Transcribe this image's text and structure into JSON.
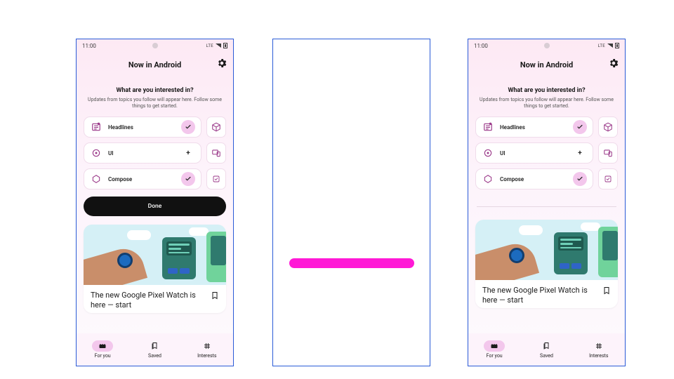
{
  "statusbar": {
    "time": "11:00",
    "network": "LTE"
  },
  "appbar": {
    "title": "Now in Android"
  },
  "onboarding": {
    "heading": "What are you interested in?",
    "subheading": "Updates from topics you follow will appear here. Follow some things to get started.",
    "done_label": "Done"
  },
  "topics": [
    {
      "icon": "headlines",
      "label": "Headlines",
      "selected": true,
      "side_icon": "cube"
    },
    {
      "icon": "ui",
      "label": "UI",
      "selected": false,
      "side_icon": "devices"
    },
    {
      "icon": "compose",
      "label": "Compose",
      "selected": true,
      "side_icon": "check-square"
    }
  ],
  "feed_card": {
    "title": "The new Google Pixel Watch is here  — start"
  },
  "nav": {
    "items": [
      {
        "key": "foryou",
        "label": "For you",
        "active": true
      },
      {
        "key": "saved",
        "label": "Saved",
        "active": false
      },
      {
        "key": "interests",
        "label": "Interests",
        "active": false
      }
    ]
  },
  "variants": {
    "left_has_done": true,
    "right_has_done": false
  }
}
